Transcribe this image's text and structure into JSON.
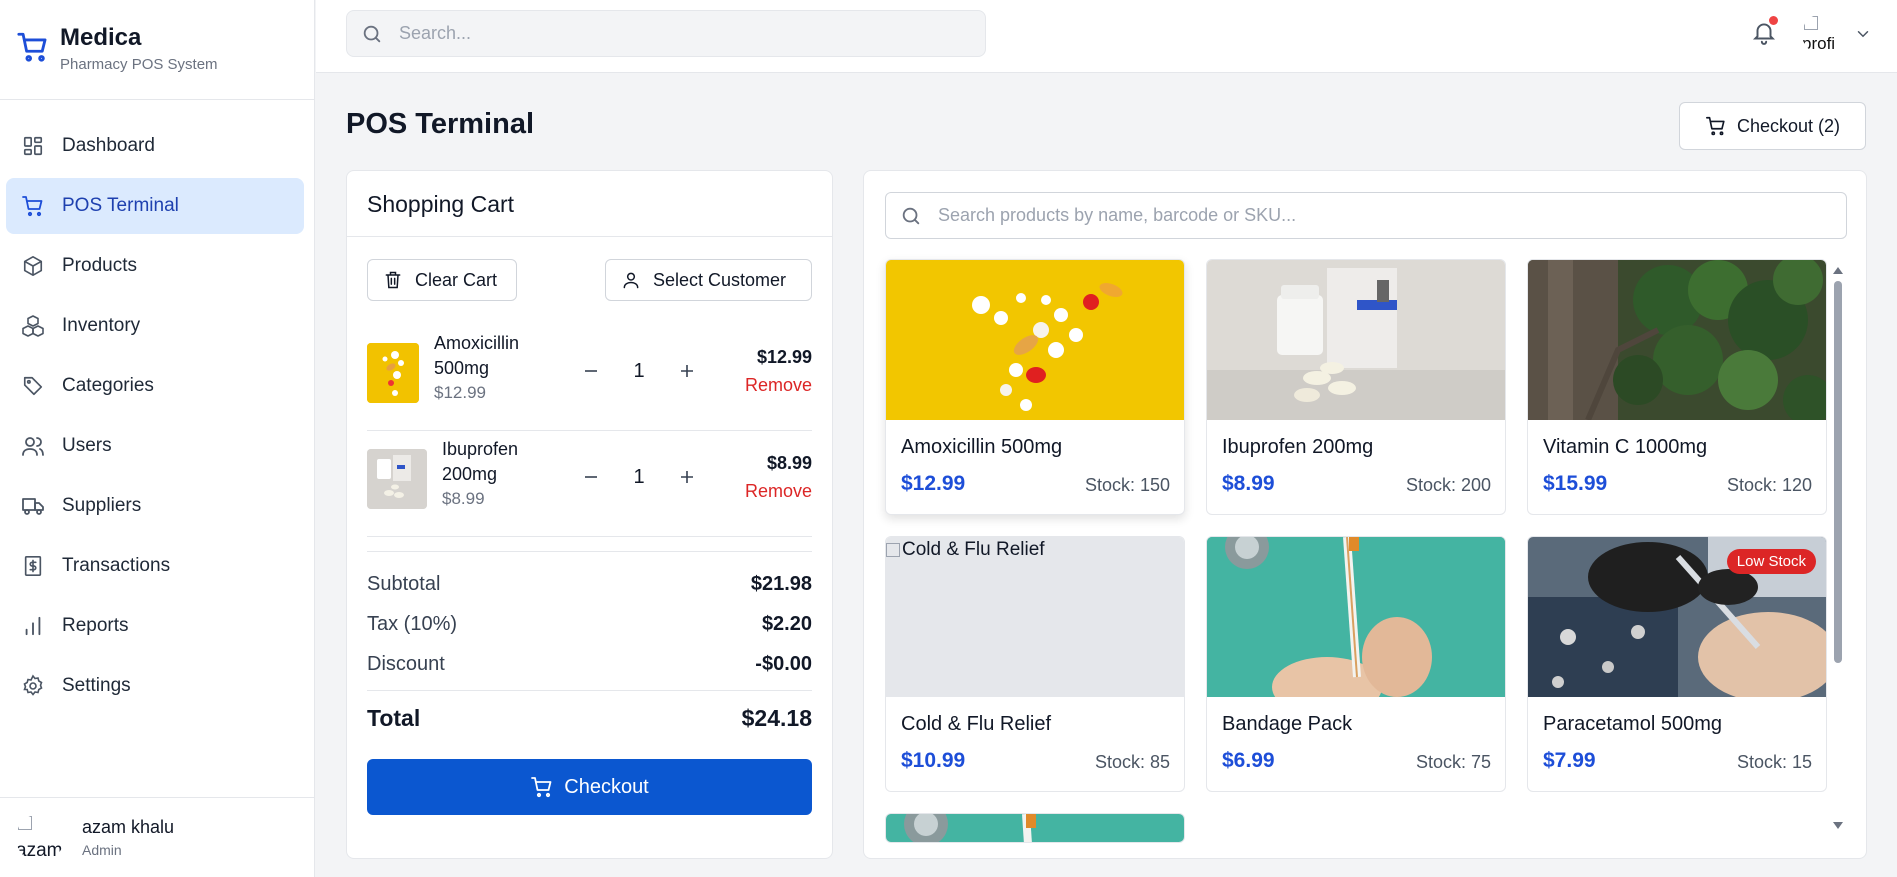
{
  "brand": {
    "name": "Medica",
    "subtitle": "Pharmacy POS System"
  },
  "sidebar": {
    "items": [
      {
        "label": "Dashboard",
        "icon": "dashboard-grid-icon",
        "active": false
      },
      {
        "label": "POS Terminal",
        "icon": "cart-icon",
        "active": true
      },
      {
        "label": "Products",
        "icon": "box-icon",
        "active": false
      },
      {
        "label": "Inventory",
        "icon": "stack-boxes-icon",
        "active": false
      },
      {
        "label": "Categories",
        "icon": "tag-icon",
        "active": false
      },
      {
        "label": "Users",
        "icon": "users-icon",
        "active": false
      },
      {
        "label": "Suppliers",
        "icon": "truck-icon",
        "active": false
      },
      {
        "label": "Transactions",
        "icon": "receipt-dollar-icon",
        "active": false
      },
      {
        "label": "Reports",
        "icon": "bar-chart-icon",
        "active": false
      },
      {
        "label": "Settings",
        "icon": "gear-icon",
        "active": false
      }
    ],
    "user": {
      "avatar_alt": "azam",
      "name": "azam khalu",
      "role": "Admin"
    }
  },
  "topbar": {
    "search_placeholder": "Search...",
    "profile_alt": "profi"
  },
  "main": {
    "title": "POS Terminal",
    "checkout_top_label": "Checkout (2)"
  },
  "cart": {
    "title": "Shopping Cart",
    "clear_label": "Clear Cart",
    "customer_label": "Select Customer",
    "items": [
      {
        "name": "Amoxicillin 500mg",
        "name_line1": "Amoxicillin",
        "name_line2": "500mg",
        "unit_price": "$12.99",
        "qty": "1",
        "line_total": "$12.99",
        "remove_label": "Remove"
      },
      {
        "name": "Ibuprofen 200mg",
        "name_line1": "Ibuprofen",
        "name_line2": "200mg",
        "unit_price": "$8.99",
        "qty": "1",
        "line_total": "$8.99",
        "remove_label": "Remove"
      }
    ],
    "totals": {
      "subtotal_label": "Subtotal",
      "subtotal": "$21.98",
      "tax_label": "Tax (10%)",
      "tax": "$2.20",
      "discount_label": "Discount",
      "discount": "-$0.00",
      "total_label": "Total",
      "total": "$24.18"
    },
    "checkout_label": "Checkout"
  },
  "products": {
    "search_placeholder": "Search products by name, barcode or SKU...",
    "items": [
      {
        "name": "Amoxicillin 500mg",
        "price": "$12.99",
        "stock": "Stock: 150",
        "image": "pills-yellow"
      },
      {
        "name": "Ibuprofen 200mg",
        "price": "$8.99",
        "stock": "Stock: 200",
        "image": "pill-bottle"
      },
      {
        "name": "Vitamin C 1000mg",
        "price": "$15.99",
        "stock": "Stock: 120",
        "image": "tree-leaves"
      },
      {
        "name": "Cold & Flu Relief",
        "price": "$10.99",
        "stock": "Stock: 85",
        "image": "broken",
        "alt": "Cold & Flu Relief"
      },
      {
        "name": "Bandage Pack",
        "price": "$6.99",
        "stock": "Stock: 75",
        "image": "syringe-hands"
      },
      {
        "name": "Paracetamol 500mg",
        "price": "$7.99",
        "stock": "Stock: 15",
        "image": "dentist",
        "badge": "Low Stock"
      }
    ]
  },
  "colors": {
    "accent": "#0b57d0",
    "price": "#1d4ed8",
    "danger": "#dc2626",
    "active_bg": "#dbeafe"
  }
}
